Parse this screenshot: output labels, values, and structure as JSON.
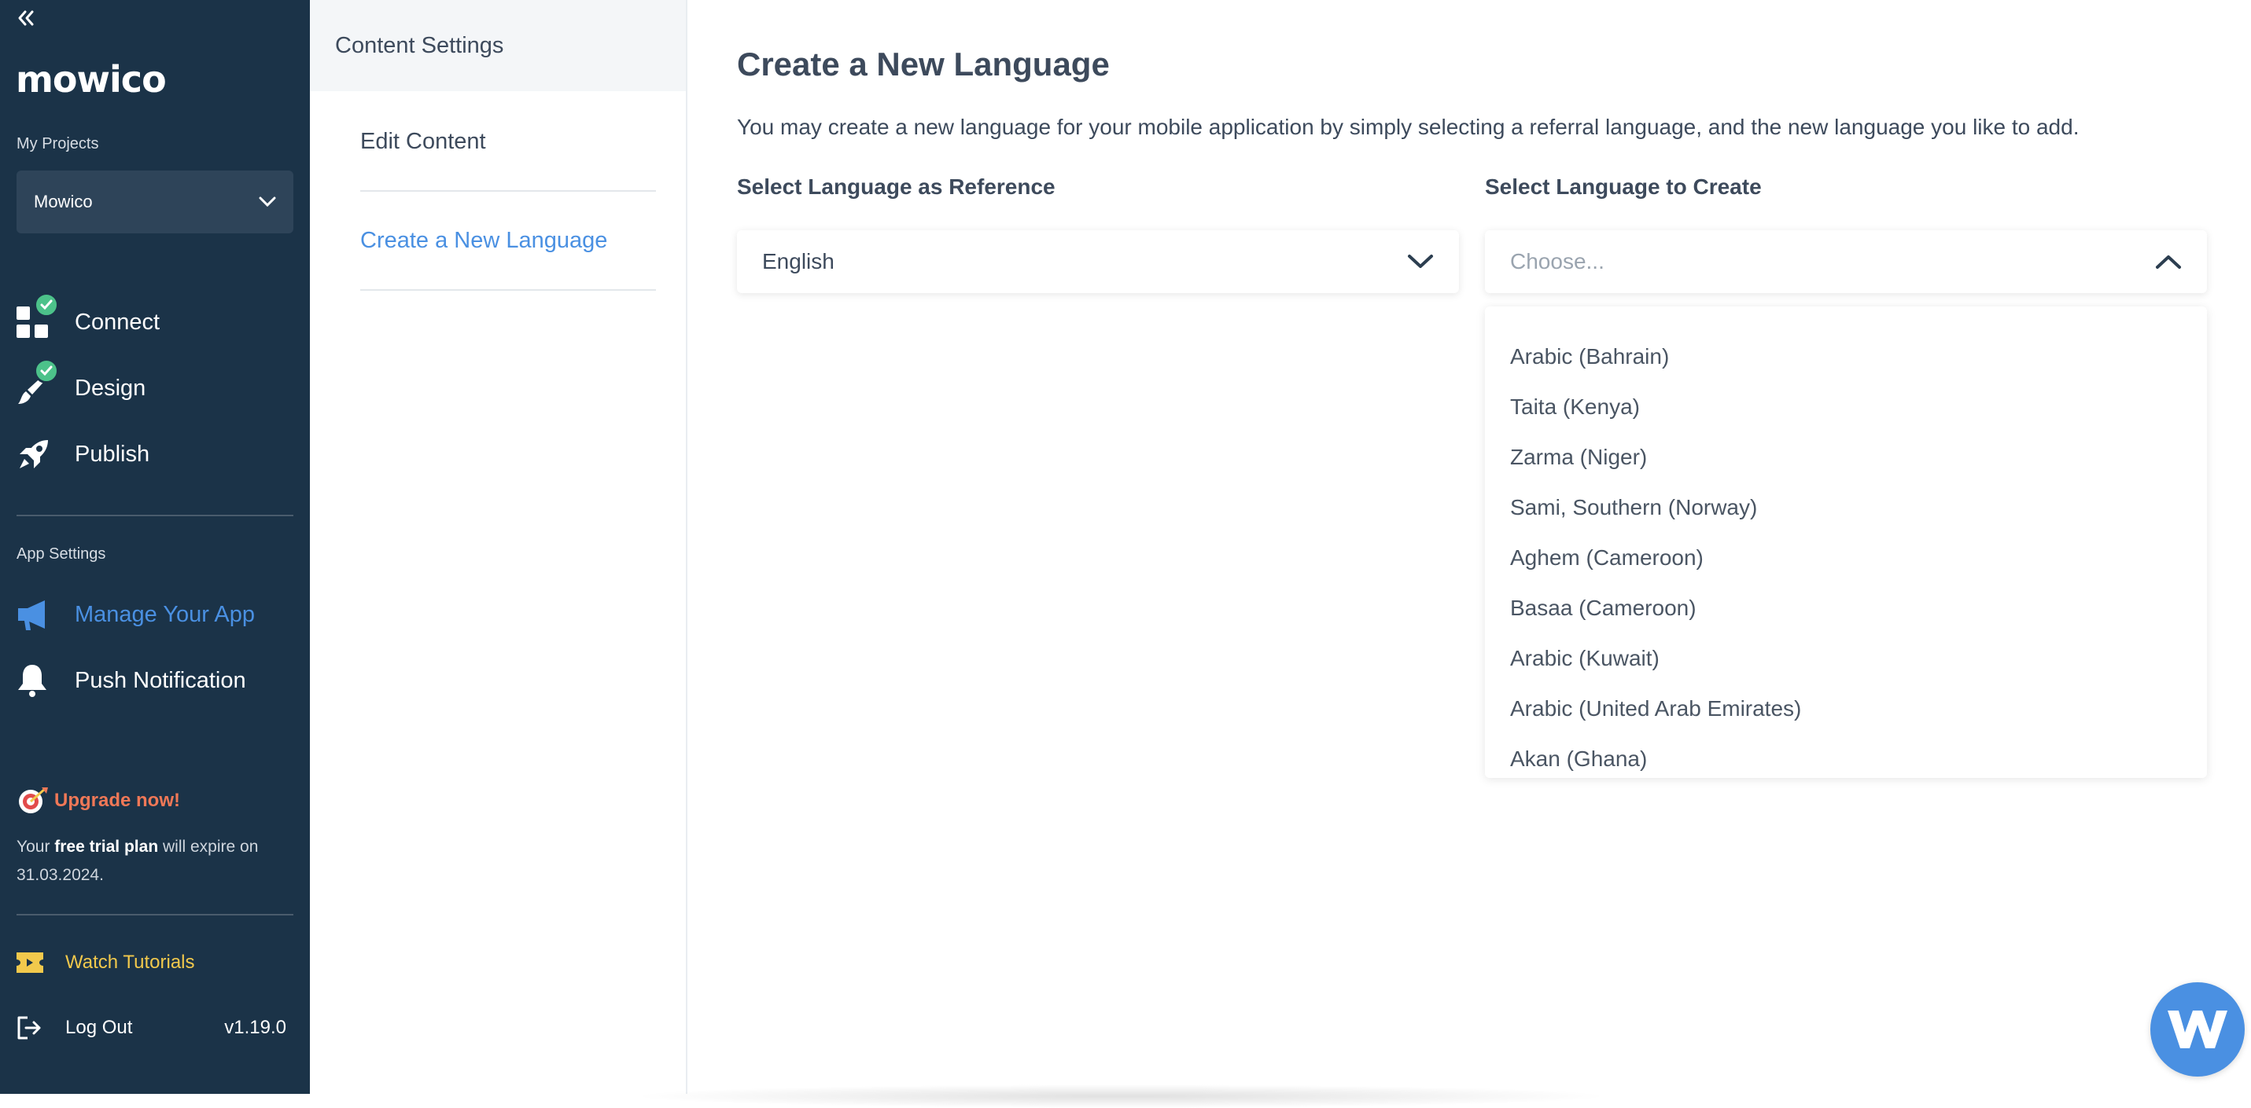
{
  "sidebar": {
    "logo": "mowico",
    "my_projects_label": "My Projects",
    "project_selected": "Mowico",
    "nav": [
      {
        "label": "Connect",
        "icon": "grid-icon",
        "completed": true
      },
      {
        "label": "Design",
        "icon": "brush-icon",
        "completed": true
      },
      {
        "label": "Publish",
        "icon": "rocket-icon",
        "completed": false
      }
    ],
    "app_settings_label": "App Settings",
    "settings_nav": [
      {
        "label": "Manage Your App",
        "icon": "megaphone-icon",
        "active": true
      },
      {
        "label": "Push Notification",
        "icon": "bell-icon",
        "active": false
      }
    ],
    "upgrade_label": "Upgrade now!",
    "trial": {
      "prefix": "Your ",
      "plan": "free trial plan",
      "suffix": " will expire on",
      "date": "31.03.2024."
    },
    "tutorials_label": "Watch Tutorials",
    "logout_label": "Log Out",
    "version": "v1.19.0"
  },
  "subpanel": {
    "header": "Content Settings",
    "items": [
      {
        "label": "Edit Content",
        "active": false
      },
      {
        "label": "Create a New Language",
        "active": true
      }
    ]
  },
  "main": {
    "title": "Create a New Language",
    "description": "You may create a new language for your mobile application by simply selecting a referral language, and the new language you like to add.",
    "reference_label": "Select Language as Reference",
    "reference_value": "English",
    "create_label": "Select Language to Create",
    "create_placeholder": "Choose...",
    "options": [
      "Arabic (Bahrain)",
      "Taita (Kenya)",
      "Zarma (Niger)",
      "Sami, Southern (Norway)",
      "Aghem (Cameroon)",
      "Basaa (Cameroon)",
      "Arabic (Kuwait)",
      "Arabic (United Arab Emirates)",
      "Akan (Ghana)"
    ]
  },
  "colors": {
    "sidebar_bg": "#1b3348",
    "accent": "#4a90e2",
    "success": "#4cc28a",
    "upgrade": "#f07857",
    "tutorials": "#f2c94c",
    "text": "#3d4a5c"
  }
}
